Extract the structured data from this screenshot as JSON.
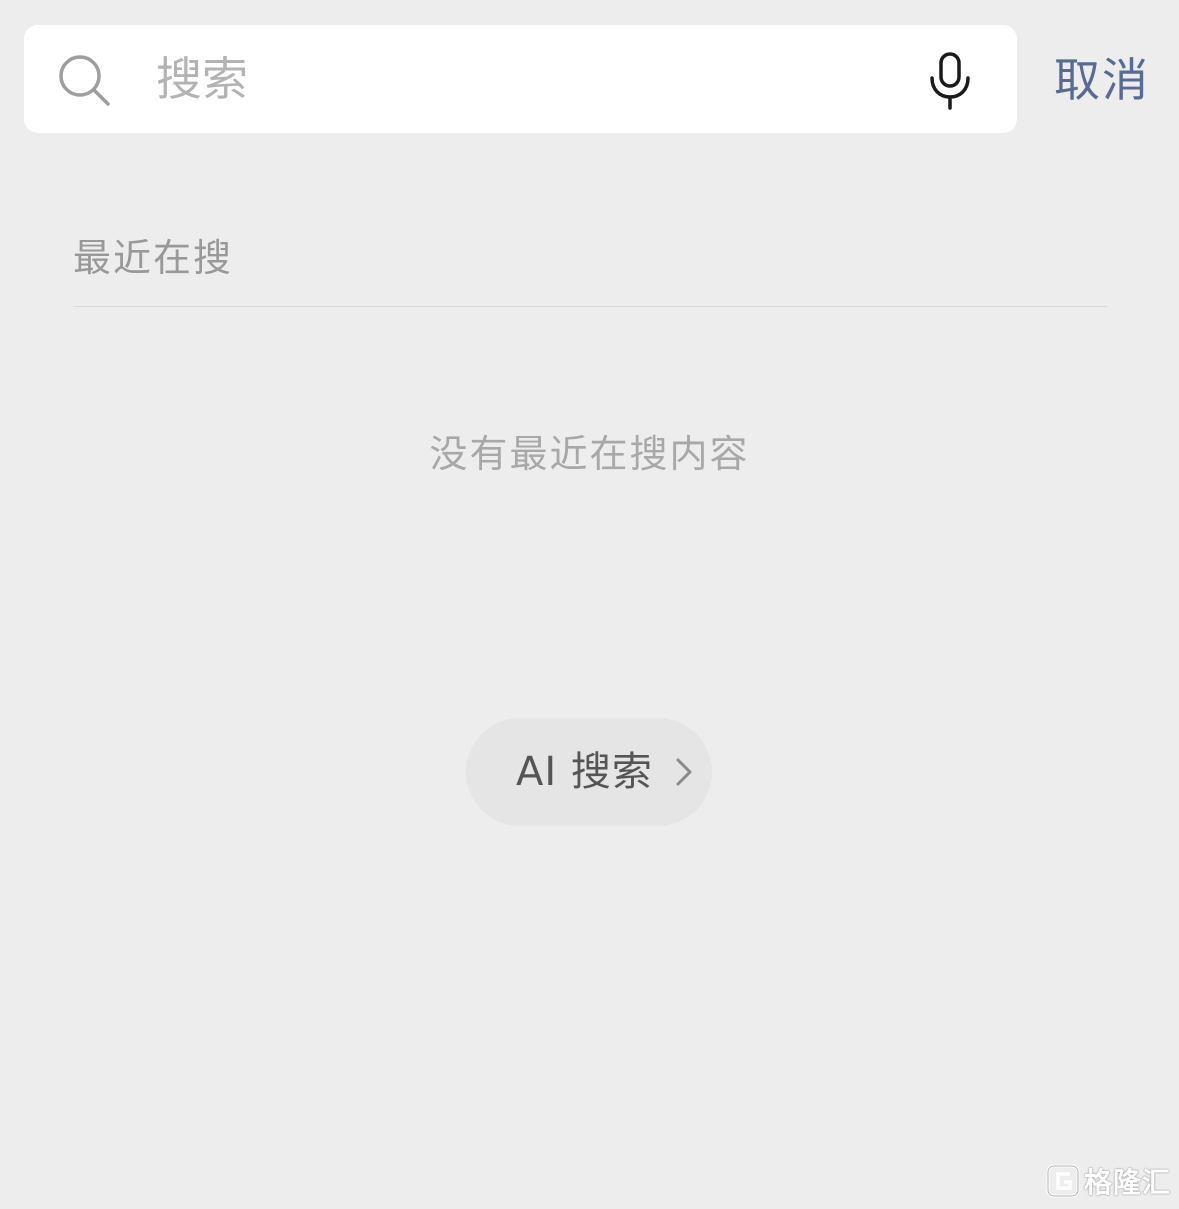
{
  "search": {
    "placeholder": "搜索",
    "value": "",
    "search_icon": "search-icon",
    "mic_icon": "microphone-icon"
  },
  "header": {
    "cancel_label": "取消"
  },
  "recent": {
    "title": "最近在搜",
    "empty_text": "没有最近在搜内容"
  },
  "ai_search": {
    "label": "AI 搜索",
    "icon": "chevron-right-icon"
  },
  "watermark": {
    "text": "格隆汇",
    "icon": "brand-logo-icon"
  },
  "colors": {
    "background": "#ededed",
    "search_bar": "#ffffff",
    "cancel": "#576b95",
    "secondary_text": "#999999",
    "ai_button_bg": "#e5e5e5"
  }
}
